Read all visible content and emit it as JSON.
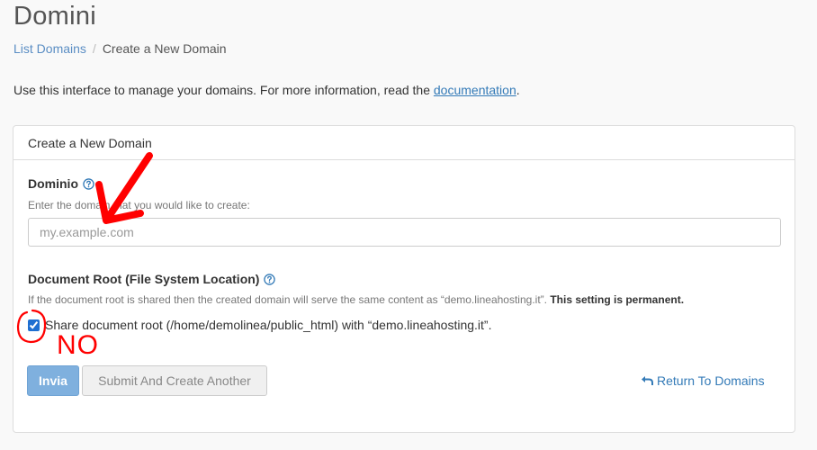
{
  "page": {
    "title": "Domini"
  },
  "breadcrumb": {
    "link": "List Domains",
    "separator": "/",
    "current": "Create a New Domain"
  },
  "intro": {
    "text": "Use this interface to manage your domains. For more information, read the ",
    "link": "documentation",
    "end": "."
  },
  "panel": {
    "heading": "Create a New Domain"
  },
  "domain_field": {
    "label": "Dominio",
    "help": "Enter the domain that you would like to create:",
    "placeholder": "my.example.com",
    "value": ""
  },
  "docroot": {
    "label": "Document Root (File System Location)",
    "help": "If the document root is shared then the created domain will serve the same content as “demo.lineahosting.it”.",
    "help_bold": "This setting is permanent.",
    "checkbox_label": "Share document root (/home/demolinea/public_html) with “demo.lineahosting.it”.",
    "checked": true
  },
  "actions": {
    "submit": "Invia",
    "submit_another": "Submit And Create Another",
    "return": "Return To Domains"
  },
  "annotation": {
    "text": "NO",
    "color": "#ff0000"
  },
  "colors": {
    "link": "#337ab7",
    "primary_button": "#7fb0de",
    "panel_border": "#dddddd"
  },
  "icons": {
    "help": "help-circle-icon",
    "return": "return-arrow-icon",
    "annotation_arrow": "red-arrow-icon",
    "annotation_circle": "red-circle-icon"
  }
}
